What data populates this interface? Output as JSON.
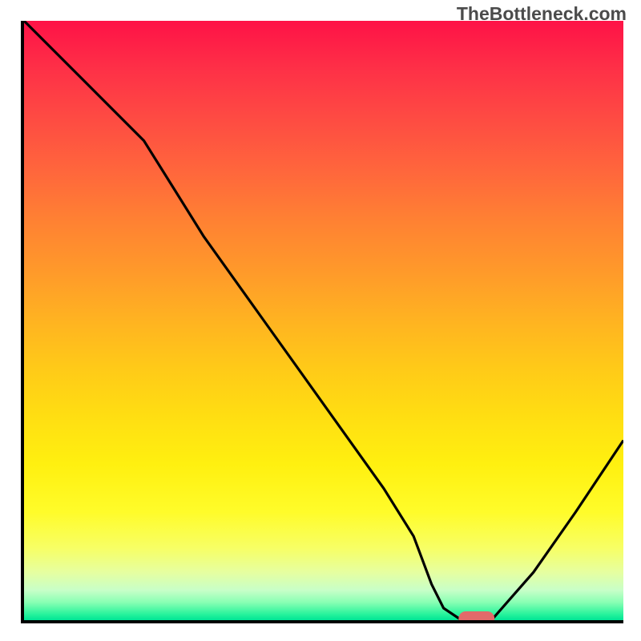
{
  "watermark": "TheBottleneck.com",
  "chart_data": {
    "type": "line",
    "title": "",
    "xlabel": "",
    "ylabel": "",
    "xlim": [
      0,
      100
    ],
    "ylim": [
      0,
      100
    ],
    "grid": false,
    "background": "red-yellow-green vertical gradient (red top, green bottom)",
    "series": [
      {
        "name": "bottleneck-curve",
        "color": "#000000",
        "x": [
          0,
          10,
          20,
          25,
          30,
          40,
          50,
          60,
          65,
          68,
          70,
          73,
          78,
          85,
          92,
          100
        ],
        "values": [
          100,
          90,
          80,
          72,
          64,
          50,
          36,
          22,
          14,
          6,
          2,
          0,
          0,
          8,
          18,
          30
        ]
      }
    ],
    "marker": {
      "name": "optimal-point",
      "x_center": 75.5,
      "y": 0,
      "width": 6,
      "color": "#e26a6a"
    },
    "annotations": []
  }
}
